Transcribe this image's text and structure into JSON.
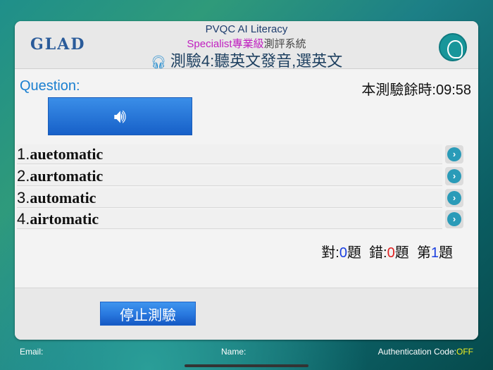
{
  "header": {
    "logo": "GLAD",
    "title1": "PVQC AI Literacy",
    "title2_highlight": "Specialist專業級",
    "title2_rest": "測評系統",
    "title3": "測驗4:聽英文發音,選英文"
  },
  "question": {
    "label": "Question:",
    "timer": "本測驗餘時:09:58",
    "play_icon": "speaker-icon"
  },
  "options": [
    {
      "num": "1.",
      "text": "auetomatic"
    },
    {
      "num": "2.",
      "text": "aurtomatic"
    },
    {
      "num": "3.",
      "text": "automatic"
    },
    {
      "num": "4.",
      "text": "airtomatic"
    }
  ],
  "score": {
    "correct_label": "對:",
    "correct": "0",
    "unit1": "題",
    "wrong_label": "錯:",
    "wrong": "0",
    "unit2": "題",
    "nth_label": "第",
    "nth": "1",
    "unit3": "題"
  },
  "stop_button": "停止測驗",
  "footer": {
    "email": "Email:",
    "name": "Name:",
    "auth_label": "Authentication Code:",
    "auth_value": "OFF"
  },
  "colors": {
    "accent": "#1a7fd0",
    "correct": "#1a3fe0",
    "wrong": "#e02020",
    "auth": "#f0f020"
  }
}
